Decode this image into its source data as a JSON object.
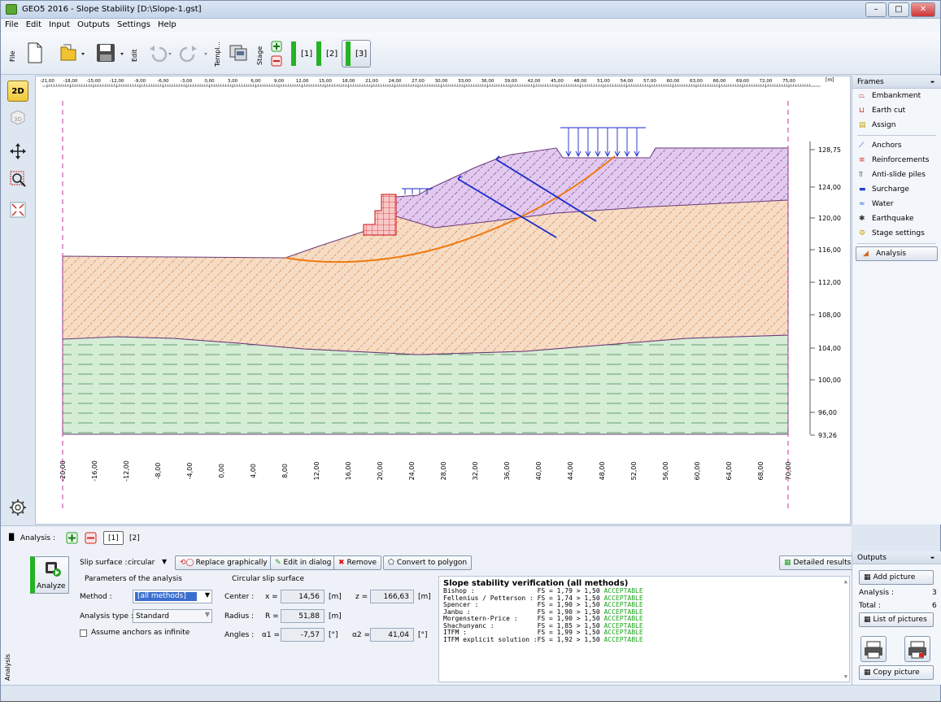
{
  "window": {
    "title": "GEO5 2016 - Slope Stability [D:\\Slope-1.gst]"
  },
  "menu": [
    "File",
    "Edit",
    "Input",
    "Outputs",
    "Settings",
    "Help"
  ],
  "toolbar": {
    "file_label": "File",
    "edit_label": "Edit",
    "templ_label": "Templ...",
    "stage_label": "Stage",
    "stages": [
      "[1]",
      "[2]",
      "[3]"
    ],
    "selected_stage": "[3]"
  },
  "view": {
    "mode_2d": "2D",
    "mode_3d": "3D"
  },
  "ruler": {
    "unit": "[m]",
    "top_ticks": [
      "-21,00",
      "-18,00",
      "-15,00",
      "-12,00",
      "-9,00",
      "-6,00",
      "-3,00",
      "0,00",
      "3,00",
      "6,00",
      "9,00",
      "12,00",
      "15,00",
      "18,00",
      "21,00",
      "24,00",
      "27,00",
      "30,00",
      "33,00",
      "36,00",
      "39,00",
      "42,00",
      "45,00",
      "48,00",
      "51,00",
      "54,00",
      "57,00",
      "60,00",
      "63,00",
      "66,00",
      "69,00",
      "72,00",
      "75,00"
    ],
    "right_ticks": [
      "128,75",
      "124,00",
      "120,00",
      "116,00",
      "112,00",
      "108,00",
      "104,00",
      "100,00",
      "96,00",
      "93,26"
    ],
    "bottom_ticks": [
      "-20,00",
      "-16,00",
      "-12,00",
      "-8,00",
      "-4,00",
      "0,00",
      "4,00",
      "8,00",
      "12,00",
      "16,00",
      "20,00",
      "24,00",
      "28,00",
      "32,00",
      "36,00",
      "40,00",
      "44,00",
      "48,00",
      "52,00",
      "56,00",
      "60,00",
      "64,00",
      "68,00",
      "70,00"
    ]
  },
  "frames": {
    "header": "Frames",
    "items": [
      {
        "label": "Embankment",
        "icon": "embankment-icon"
      },
      {
        "label": "Earth cut",
        "icon": "earth-cut-icon"
      },
      {
        "label": "Assign",
        "icon": "assign-icon"
      },
      {
        "label": "Anchors",
        "icon": "anchors-icon"
      },
      {
        "label": "Reinforcements",
        "icon": "reinforcements-icon"
      },
      {
        "label": "Anti-slide piles",
        "icon": "anti-slide-piles-icon"
      },
      {
        "label": "Surcharge",
        "icon": "surcharge-icon"
      },
      {
        "label": "Water",
        "icon": "water-icon"
      },
      {
        "label": "Earthquake",
        "icon": "earthquake-icon"
      },
      {
        "label": "Stage settings",
        "icon": "stage-settings-icon"
      },
      {
        "label": "Analysis",
        "icon": "analysis-icon",
        "selected": true
      }
    ]
  },
  "analysis_panel": {
    "label": "Analysis :",
    "tabs": [
      "[1]",
      "[2]"
    ],
    "analyze": "Analyze",
    "slip_surface_label": "Slip surface :",
    "slip_surface_value": "circular",
    "replace_graphically": "Replace graphically",
    "edit_in_dialog": "Edit in dialog",
    "remove": "Remove",
    "convert_to_polygon": "Convert to polygon",
    "detailed_results": "Detailed results",
    "params_title": "Parameters of the analysis",
    "method_label": "Method :",
    "method_value": "[all methods]",
    "analysis_type_label": "Analysis type :",
    "analysis_type_value": "Standard",
    "assume_anchors": "Assume anchors as infinite",
    "circle_title": "Circular slip surface",
    "center_label": "Center :",
    "x_label": "x =",
    "x_value": "14,56",
    "z_label": "z =",
    "z_value": "166,63",
    "radius_label": "Radius :",
    "r_label": "R =",
    "r_value": "51,88",
    "angles_label": "Angles :",
    "a1_label": "α1 =",
    "a1_value": "-7,57",
    "a2_label": "α2 =",
    "a2_value": "41,04",
    "unit_m": "[m]",
    "unit_deg": "[°]",
    "side_label": "Analysis"
  },
  "results": {
    "title": "Slope stability verification (all methods)",
    "rows": [
      {
        "method": "Bishop :",
        "fs": "FS = 1,79 > 1,50",
        "status": "ACCEPTABLE"
      },
      {
        "method": "Fellenius / Petterson :",
        "fs": "FS = 1,74 > 1,50",
        "status": "ACCEPTABLE"
      },
      {
        "method": "Spencer :",
        "fs": "FS = 1,90 > 1,50",
        "status": "ACCEPTABLE"
      },
      {
        "method": "Janbu :",
        "fs": "FS = 1,90 > 1,50",
        "status": "ACCEPTABLE"
      },
      {
        "method": "Morgenstern-Price :",
        "fs": "FS = 1,90 > 1,50",
        "status": "ACCEPTABLE"
      },
      {
        "method": "Shachunyanc :",
        "fs": "FS = 1,85 > 1,50",
        "status": "ACCEPTABLE"
      },
      {
        "method": "ITFM :",
        "fs": "FS = 1,99 > 1,50",
        "status": "ACCEPTABLE"
      },
      {
        "method": "ITFM explicit solution :",
        "fs": "FS = 1,92 > 1,50",
        "status": "ACCEPTABLE"
      }
    ]
  },
  "outputs": {
    "header": "Outputs",
    "add_picture": "Add picture",
    "analysis_label": "Analysis :",
    "analysis_count": "3",
    "total_label": "Total :",
    "total_count": "6",
    "list_of_pictures": "List of pictures",
    "copy_picture": "Copy picture"
  },
  "colors": {
    "accent_green": "#25b225",
    "soil_orange": "#f6dcc4",
    "soil_violet": "#e3c9ef",
    "soil_green": "#d5ecd5",
    "slip_orange": "#f07a10",
    "anchor_blue": "#1a2acd"
  }
}
